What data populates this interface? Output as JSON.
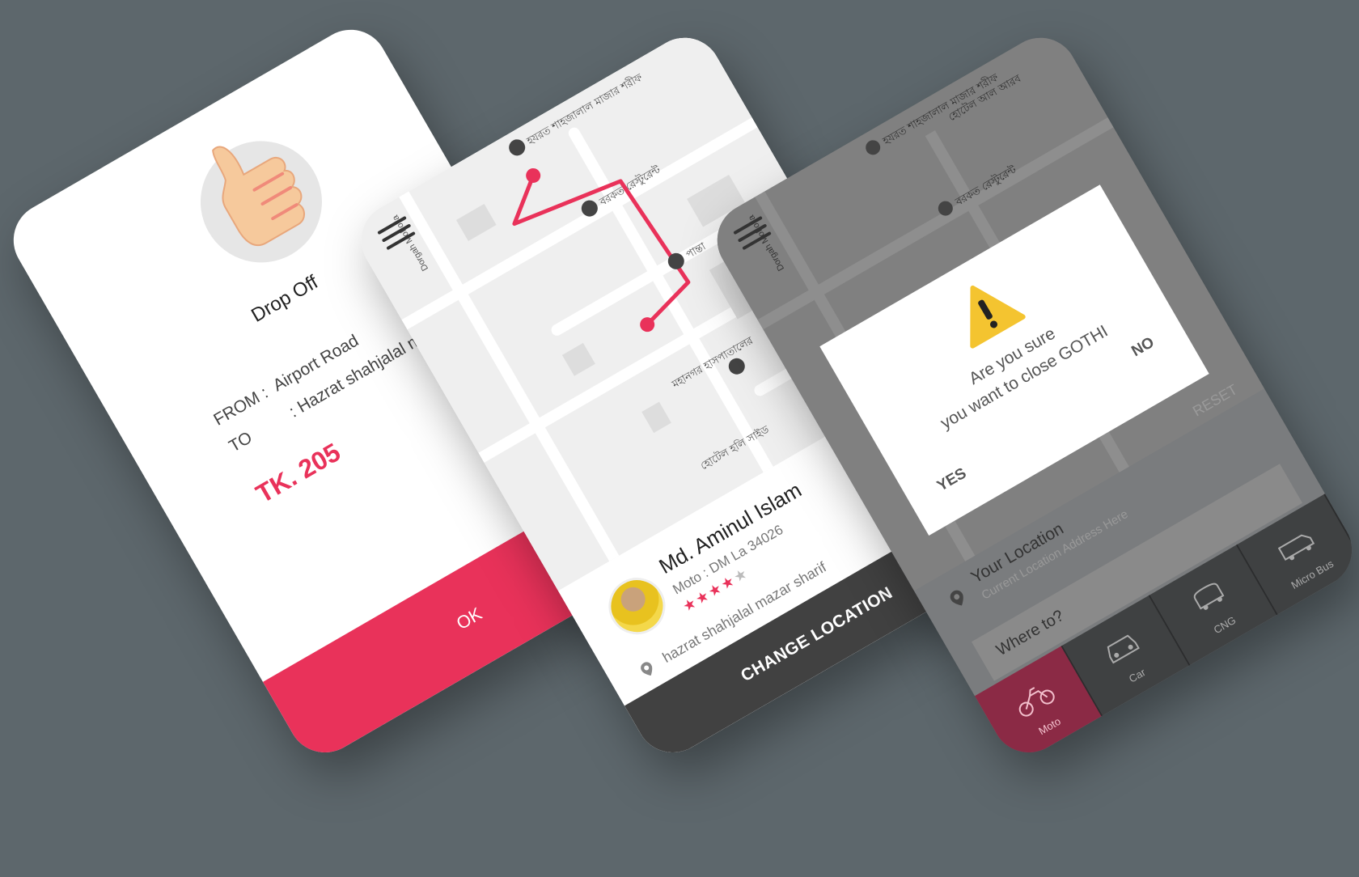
{
  "colors": {
    "background": "#5d676c",
    "accent": "#e9325a",
    "dark_button": "#414141"
  },
  "dropoff_screen": {
    "title": "Drop Off",
    "from_label": "FROM :",
    "from_value": "Airport Road",
    "to_label": "TO",
    "to_value": ":  Hazrat shahjalal mazar sharif",
    "fare": "TK. 205",
    "ok_label": "OK"
  },
  "driver_screen": {
    "map_labels": {
      "road_label": "Dorgah Moholla",
      "place_1": "হযরত শাহজালাল মাজার শরীফ",
      "place_2": "বরকত রেস্টুরেন্ট",
      "place_3": "পান্তা",
      "place_4": "মহানগর হাসপাতালের",
      "place_5": "হোটেল হলি সাইড"
    },
    "driver_name": "Md. Aminul Islam",
    "driver_vehicle": "Moto : DM La 34026",
    "rating": 4,
    "rating_max": 5,
    "destination": "hazrat shahjalal mazar sharif",
    "change_location_label": "CHANGE LOCATION"
  },
  "confirm_screen": {
    "dialog_line1": "Are you sure",
    "dialog_line2": "you want to close GOTHI",
    "yes_label": "YES",
    "no_label": "NO",
    "reset_label": "RESET",
    "your_location_label": "Your Location",
    "location_placeholder": "Current Location Address Here",
    "where_to_label": "Where to?",
    "vehicles": [
      {
        "label": "Moto",
        "icon": "motorbike-icon",
        "active": true
      },
      {
        "label": "Car",
        "icon": "car-icon",
        "active": false
      },
      {
        "label": "CNG",
        "icon": "cng-icon",
        "active": false
      },
      {
        "label": "Micro Bus",
        "icon": "microbus-icon",
        "active": false
      }
    ],
    "map_labels": {
      "road_label": "Dorgah Moholla",
      "place_1": "হযরত শাহজালাল মাজার শরীফ",
      "place_2": "বরকত রেস্টুরেন্ট",
      "place_3": "হোটেল আল আরব"
    }
  }
}
